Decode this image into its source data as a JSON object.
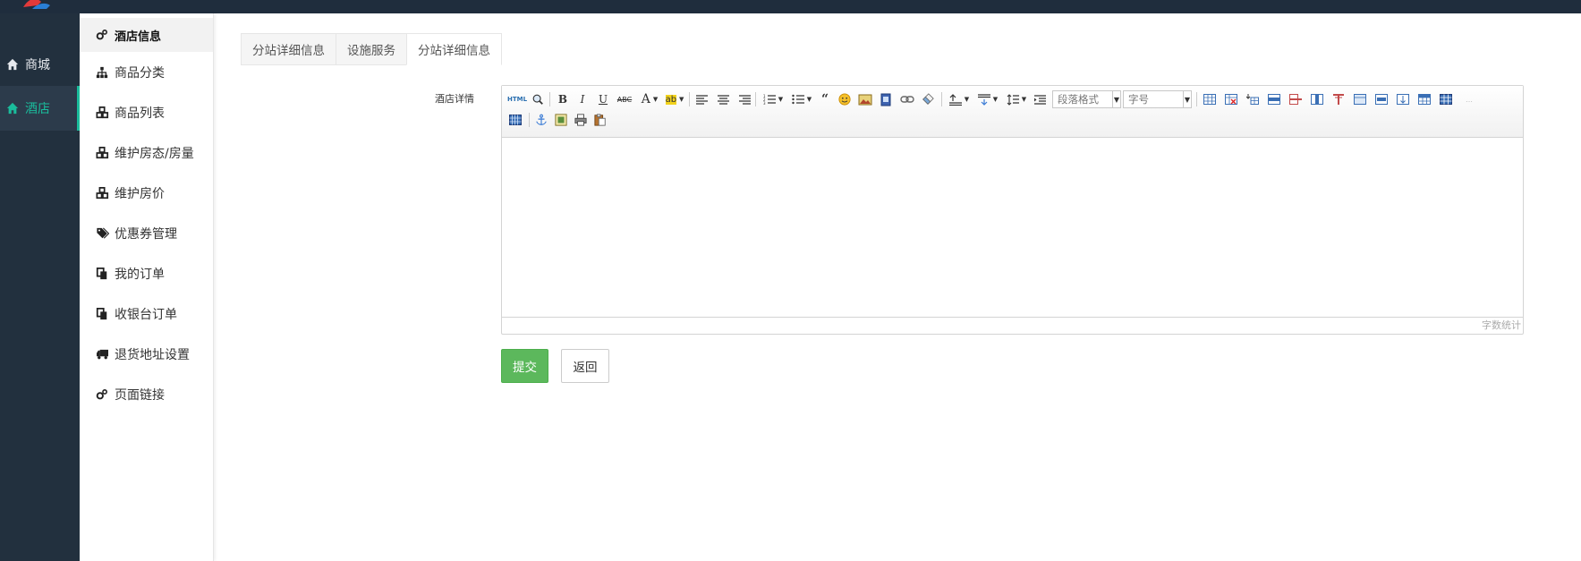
{
  "colors": {
    "topbar": "#1f2d3d",
    "left_nav_bg": "#22303e",
    "accent": "#1abc9c",
    "submit": "#5cb85c"
  },
  "left_nav": {
    "items": [
      {
        "label": "商城",
        "icon": "home-icon",
        "active": false
      },
      {
        "label": "酒店",
        "icon": "home-icon",
        "active": true
      }
    ]
  },
  "sub_nav": {
    "header": {
      "label": "酒店信息",
      "icon": "cogs-icon"
    },
    "items": [
      {
        "label": "商品分类",
        "icon": "sitemap-icon"
      },
      {
        "label": "商品列表",
        "icon": "cubes-icon"
      },
      {
        "label": "维护房态/房量",
        "icon": "cubes-icon"
      },
      {
        "label": "维护房价",
        "icon": "cubes-icon"
      },
      {
        "label": "优惠券管理",
        "icon": "tags-icon"
      },
      {
        "label": "我的订单",
        "icon": "copy-icon"
      },
      {
        "label": "收银台订单",
        "icon": "copy-icon"
      },
      {
        "label": "退货地址设置",
        "icon": "truck-icon"
      },
      {
        "label": "页面链接",
        "icon": "cogs-icon"
      }
    ]
  },
  "tabs": [
    {
      "label": "分站详细信息",
      "active": false
    },
    {
      "label": "设施服务",
      "active": false
    },
    {
      "label": "分站详细信息",
      "active": true
    }
  ],
  "form": {
    "detail_label": "酒店详情",
    "editor": {
      "paragraph_format": "段落格式",
      "font_size": "字号",
      "word_count": "字数统计"
    },
    "submit_label": "提交",
    "back_label": "返回"
  }
}
